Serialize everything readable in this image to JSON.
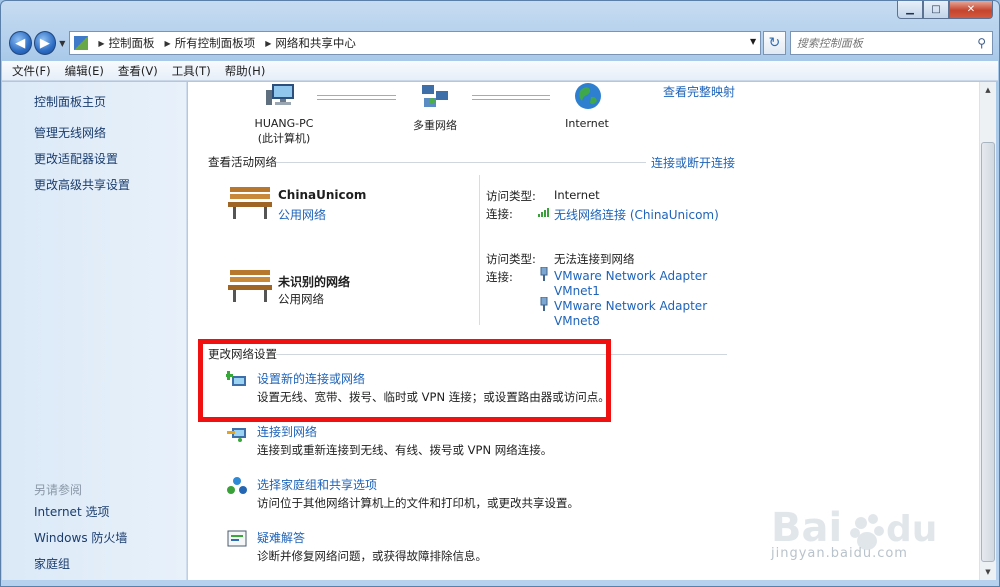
{
  "window": {
    "minimize": "▁",
    "maximize": "□",
    "close": "✕"
  },
  "nav": {
    "back": "◀",
    "forward": "▶",
    "breadcrumbs": [
      "控制面板",
      "所有控制面板项",
      "网络和共享中心"
    ],
    "search_placeholder": "搜索控制面板"
  },
  "menu": [
    "文件(F)",
    "编辑(E)",
    "查看(V)",
    "工具(T)",
    "帮助(H)"
  ],
  "sidebar": {
    "home": "控制面板主页",
    "tasks": [
      "管理无线网络",
      "更改适配器设置",
      "更改高级共享设置"
    ],
    "see_also_title": "另请参阅",
    "related": [
      "Internet 选项",
      "Windows 防火墙",
      "家庭组"
    ]
  },
  "map": {
    "view_full_map": "查看完整映射",
    "nodes": [
      {
        "name": "HUANG-PC",
        "sub": "(此计算机)"
      },
      {
        "name": "多重网络",
        "sub": ""
      },
      {
        "name": "Internet",
        "sub": ""
      }
    ]
  },
  "active": {
    "title": "查看活动网络",
    "connect_link": "连接或断开连接",
    "networks": [
      {
        "name": "ChinaUnicom",
        "type": "公用网络",
        "type_is_link": true,
        "access_label": "访问类型:",
        "access_value": "Internet",
        "conn_label": "连接:",
        "connections": [
          "无线网络连接 (ChinaUnicom)"
        ]
      },
      {
        "name": "未识别的网络",
        "type": "公用网络",
        "type_is_link": false,
        "access_label": "访问类型:",
        "access_value": "无法连接到网络",
        "conn_label": "连接:",
        "connections": [
          "VMware Network Adapter",
          "VMnet1",
          "VMware Network Adapter",
          "VMnet8"
        ]
      }
    ]
  },
  "change": {
    "title": "更改网络设置",
    "tasks": [
      {
        "link": "设置新的连接或网络",
        "desc": "设置无线、宽带、拨号、临时或 VPN 连接；或设置路由器或访问点。"
      },
      {
        "link": "连接到网络",
        "desc": "连接到或重新连接到无线、有线、拨号或 VPN 网络连接。"
      },
      {
        "link": "选择家庭组和共享选项",
        "desc": "访问位于其他网络计算机上的文件和打印机，或更改共享设置。"
      },
      {
        "link": "疑难解答",
        "desc": "诊断并修复网络问题，或获得故障排除信息。"
      }
    ]
  },
  "watermark": {
    "text": "jingyan.baidu.com"
  },
  "colors": {
    "link": "#1e63b9",
    "highlight": "#f01010"
  }
}
